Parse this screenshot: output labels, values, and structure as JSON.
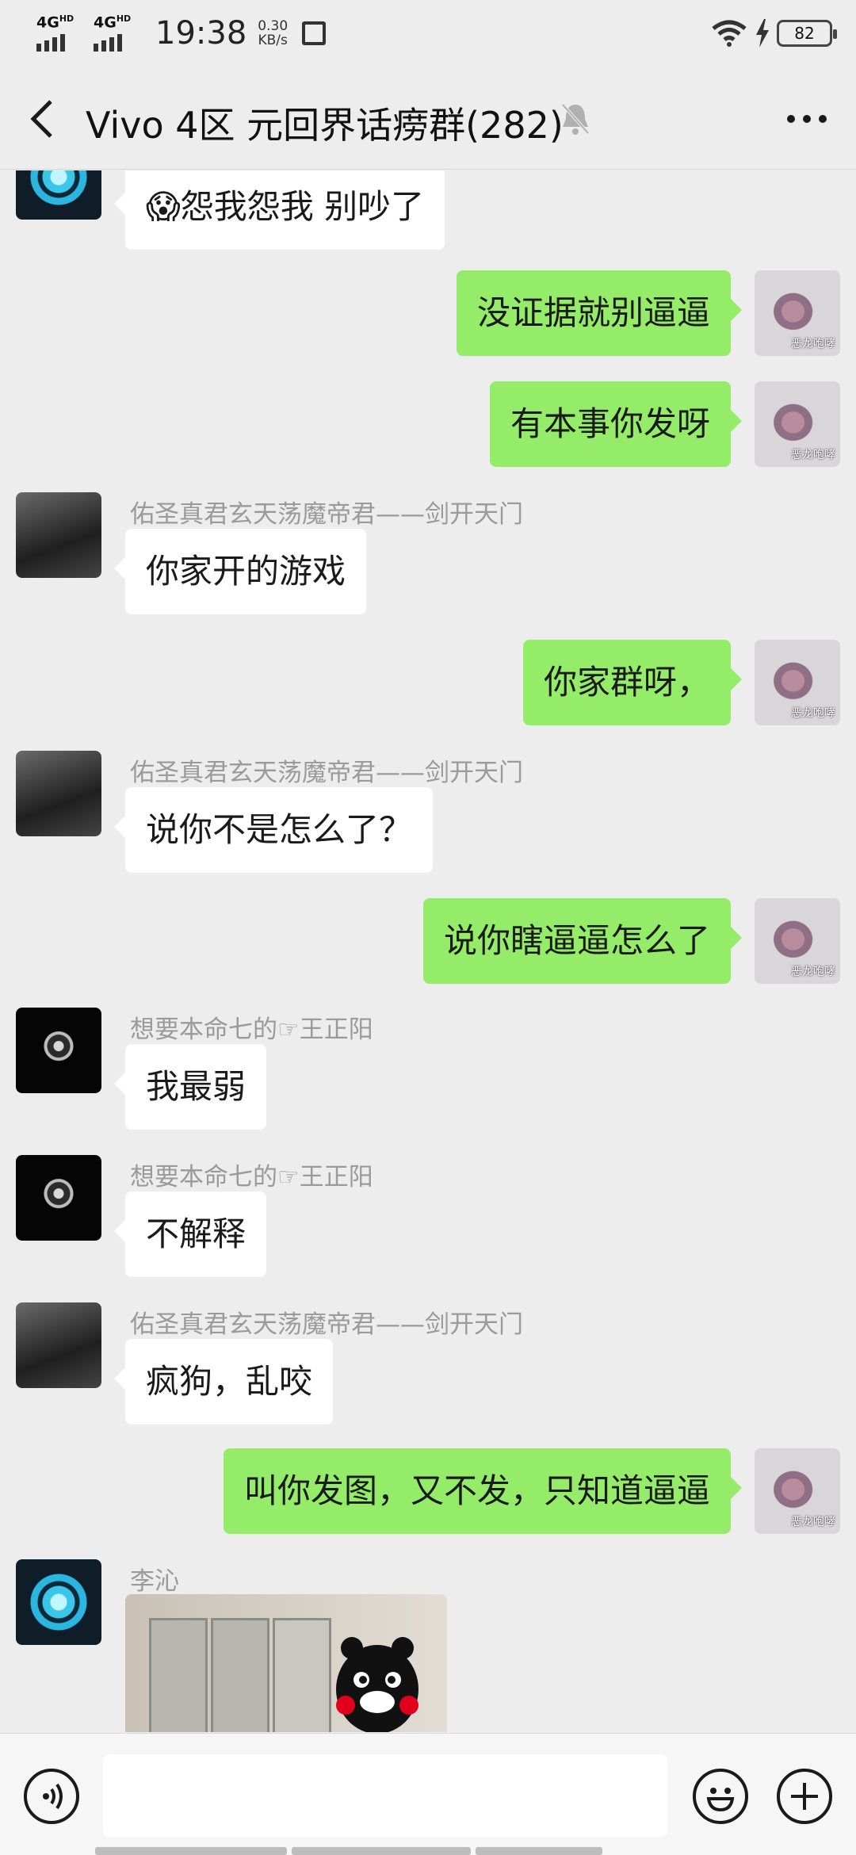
{
  "status_bar": {
    "network1": "4G",
    "network1_suffix": "HD",
    "network2": "4G",
    "network2_suffix": "HD",
    "time": "19:38",
    "speed_value": "0.30",
    "speed_unit": "KB/s",
    "battery": "82"
  },
  "header": {
    "title": "Vivo 4区 元回界话痨群(282)"
  },
  "messages": [
    {
      "side": "in",
      "text": "😱怨我怨我 别吵了",
      "avatar": "iron-man-arc-reactor"
    },
    {
      "side": "out",
      "text": "没证据就别逼逼"
    },
    {
      "side": "out",
      "text": "有本事你发呀"
    },
    {
      "side": "in",
      "sender": "佑圣真君玄天荡魔帝君——剑开天门",
      "text": "你家开的游戏"
    },
    {
      "side": "out",
      "text": "你家群呀，"
    },
    {
      "side": "in",
      "sender": "佑圣真君玄天荡魔帝君——剑开天门",
      "text": "说你不是怎么了？"
    },
    {
      "side": "out",
      "text": "说你瞎逼逼怎么了"
    },
    {
      "side": "in",
      "sender": "想要本命七的☞王正阳",
      "text": "我最弱"
    },
    {
      "side": "in",
      "sender": "想要本命七的☞王正阳",
      "text": "不解释"
    },
    {
      "side": "in",
      "sender": "佑圣真君玄天荡魔帝君——剑开天门",
      "text": "疯狗，乱咬"
    },
    {
      "side": "out",
      "text": "叫你发图，又不发，只知道逼逼"
    },
    {
      "side": "in",
      "sender": "李沁",
      "type": "image"
    }
  ],
  "self_avatar_tag": "恶龙咆哮",
  "icons": {
    "back": "back-arrow-icon",
    "mute": "bell-muted-icon",
    "more": "more-dots-icon",
    "voice": "voice-icon",
    "emoji": "emoji-icon",
    "plus": "plus-icon"
  },
  "colors": {
    "outgoing_bubble": "#95ec69",
    "incoming_bubble": "#ffffff",
    "background": "#ededed"
  }
}
